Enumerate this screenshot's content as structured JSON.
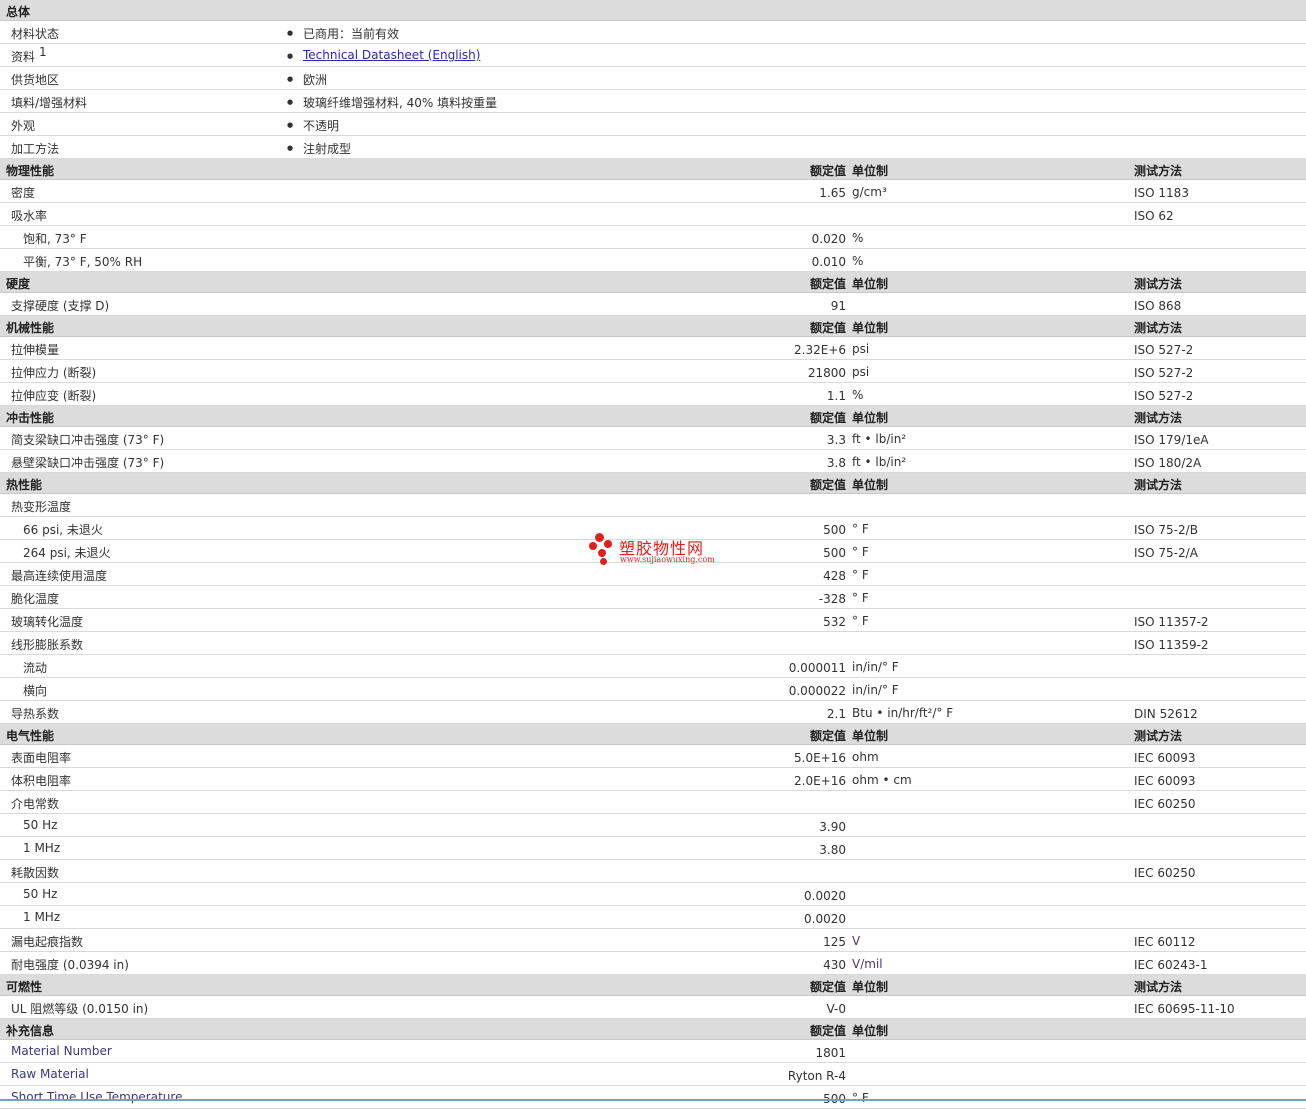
{
  "general": {
    "title": "总体",
    "rows": [
      {
        "name": "材料状态",
        "value": "已商用：当前有效"
      },
      {
        "name": "资料",
        "sup": "1",
        "value": "Technical Datasheet (English)",
        "link": true
      },
      {
        "name": "供货地区",
        "value": "欧洲"
      },
      {
        "name": "填料/增强材料",
        "value": "玻璃纤维增强材料, 40% 填料按重量"
      },
      {
        "name": "外观",
        "value": "不透明"
      },
      {
        "name": "加工方法",
        "value": "注射成型"
      }
    ]
  },
  "column_labels": {
    "value": "额定值",
    "unit": "单位制",
    "test": "测试方法"
  },
  "sections": [
    {
      "title": "物理性能",
      "show_test": true,
      "rows": [
        {
          "name": "密度",
          "value": "1.65",
          "unit": "g/cm³",
          "test": "ISO 1183"
        },
        {
          "name": "吸水率",
          "value": "",
          "unit": "",
          "test": "ISO 62"
        },
        {
          "name": "饱和, 73° F",
          "indent": true,
          "value": "0.020",
          "unit": "%",
          "test": ""
        },
        {
          "name": "平衡, 73° F, 50% RH",
          "indent": true,
          "value": "0.010",
          "unit": "%",
          "test": ""
        }
      ]
    },
    {
      "title": "硬度",
      "show_test": true,
      "rows": [
        {
          "name": "支撑硬度 (支撑 D)",
          "value": "91",
          "unit": "",
          "test": "ISO 868"
        }
      ]
    },
    {
      "title": "机械性能",
      "show_test": true,
      "rows": [
        {
          "name": "拉伸模量",
          "value": "2.32E+6",
          "unit": "psi",
          "test": "ISO 527-2"
        },
        {
          "name": "拉伸应力 (断裂)",
          "value": "21800",
          "unit": "psi",
          "test": "ISO 527-2"
        },
        {
          "name": "拉伸应变 (断裂)",
          "value": "1.1",
          "unit": "%",
          "test": "ISO 527-2"
        }
      ]
    },
    {
      "title": "冲击性能",
      "show_test": true,
      "rows": [
        {
          "name": "简支梁缺口冲击强度 (73° F)",
          "value": "3.3",
          "unit": "ft • lb/in²",
          "test": "ISO 179/1eA"
        },
        {
          "name": "悬壁梁缺口冲击强度 (73° F)",
          "value": "3.8",
          "unit": "ft • lb/in²",
          "test": "ISO 180/2A"
        }
      ]
    },
    {
      "title": "热性能",
      "show_test": true,
      "rows": [
        {
          "name": "热变形温度",
          "value": "",
          "unit": "",
          "test": ""
        },
        {
          "name": "66 psi, 未退火",
          "indent": true,
          "value": "500",
          "unit": "° F",
          "test": "ISO 75-2/B"
        },
        {
          "name": "264 psi, 未退火",
          "indent": true,
          "value": "500",
          "unit": "° F",
          "test": "ISO 75-2/A"
        },
        {
          "name": "最高连续使用温度",
          "value": "428",
          "unit": "° F",
          "test": ""
        },
        {
          "name": "脆化温度",
          "value": "-328",
          "unit": "° F",
          "test": ""
        },
        {
          "name": "玻璃转化温度",
          "value": "532",
          "unit": "° F",
          "test": "ISO 11357-2"
        },
        {
          "name": "线形膨胀系数",
          "value": "",
          "unit": "",
          "test": "ISO 11359-2"
        },
        {
          "name": "流动",
          "indent": true,
          "value": "0.000011",
          "unit": "in/in/° F",
          "test": ""
        },
        {
          "name": "横向",
          "indent": true,
          "value": "0.000022",
          "unit": "in/in/° F",
          "test": ""
        },
        {
          "name": "导热系数",
          "value": "2.1",
          "unit": "Btu • in/hr/ft²/° F",
          "test": "DIN 52612"
        }
      ]
    },
    {
      "title": "电气性能",
      "show_test": true,
      "rows": [
        {
          "name": "表面电阻率",
          "value": "5.0E+16",
          "unit": "ohm",
          "test": "IEC 60093"
        },
        {
          "name": "体积电阻率",
          "value": "2.0E+16",
          "unit": "ohm • cm",
          "test": "IEC 60093"
        },
        {
          "name": "介电常数",
          "value": "",
          "unit": "",
          "test": "IEC 60250"
        },
        {
          "name": "50 Hz",
          "indent": true,
          "value": "3.90",
          "unit": "",
          "test": ""
        },
        {
          "name": "1 MHz",
          "indent": true,
          "value": "3.80",
          "unit": "",
          "test": ""
        },
        {
          "name": "耗散因数",
          "value": "",
          "unit": "",
          "test": "IEC 60250"
        },
        {
          "name": "50 Hz",
          "indent": true,
          "value": "0.0020",
          "unit": "",
          "test": ""
        },
        {
          "name": "1 MHz",
          "indent": true,
          "value": "0.0020",
          "unit": "",
          "test": ""
        },
        {
          "name": "漏电起痕指数",
          "value": "125",
          "unit": "V",
          "test": "IEC 60112"
        },
        {
          "name": "耐电强度 (0.0394 in)",
          "value": "430",
          "unit": "V/mil",
          "test": "IEC 60243-1"
        }
      ]
    },
    {
      "title": "可燃性",
      "show_test": true,
      "rows": [
        {
          "name": "UL 阻燃等级 (0.0150 in)",
          "value": "V-0",
          "unit": "",
          "test": "IEC 60695-11-10"
        }
      ]
    },
    {
      "title": "补充信息",
      "show_test": false,
      "rows": [
        {
          "name": "Material Number",
          "value": "1801",
          "unit": "",
          "test": "",
          "blue": true
        },
        {
          "name": "Raw Material",
          "value": "Ryton R-4",
          "unit": "",
          "test": "",
          "blue": true
        },
        {
          "name": "Short Time Use Temperature",
          "value": "500",
          "unit": "° F",
          "test": "",
          "blue": true
        }
      ]
    }
  ],
  "watermark": {
    "name": "塑胶物性网",
    "url": "www.sujiaowuxing.com"
  }
}
